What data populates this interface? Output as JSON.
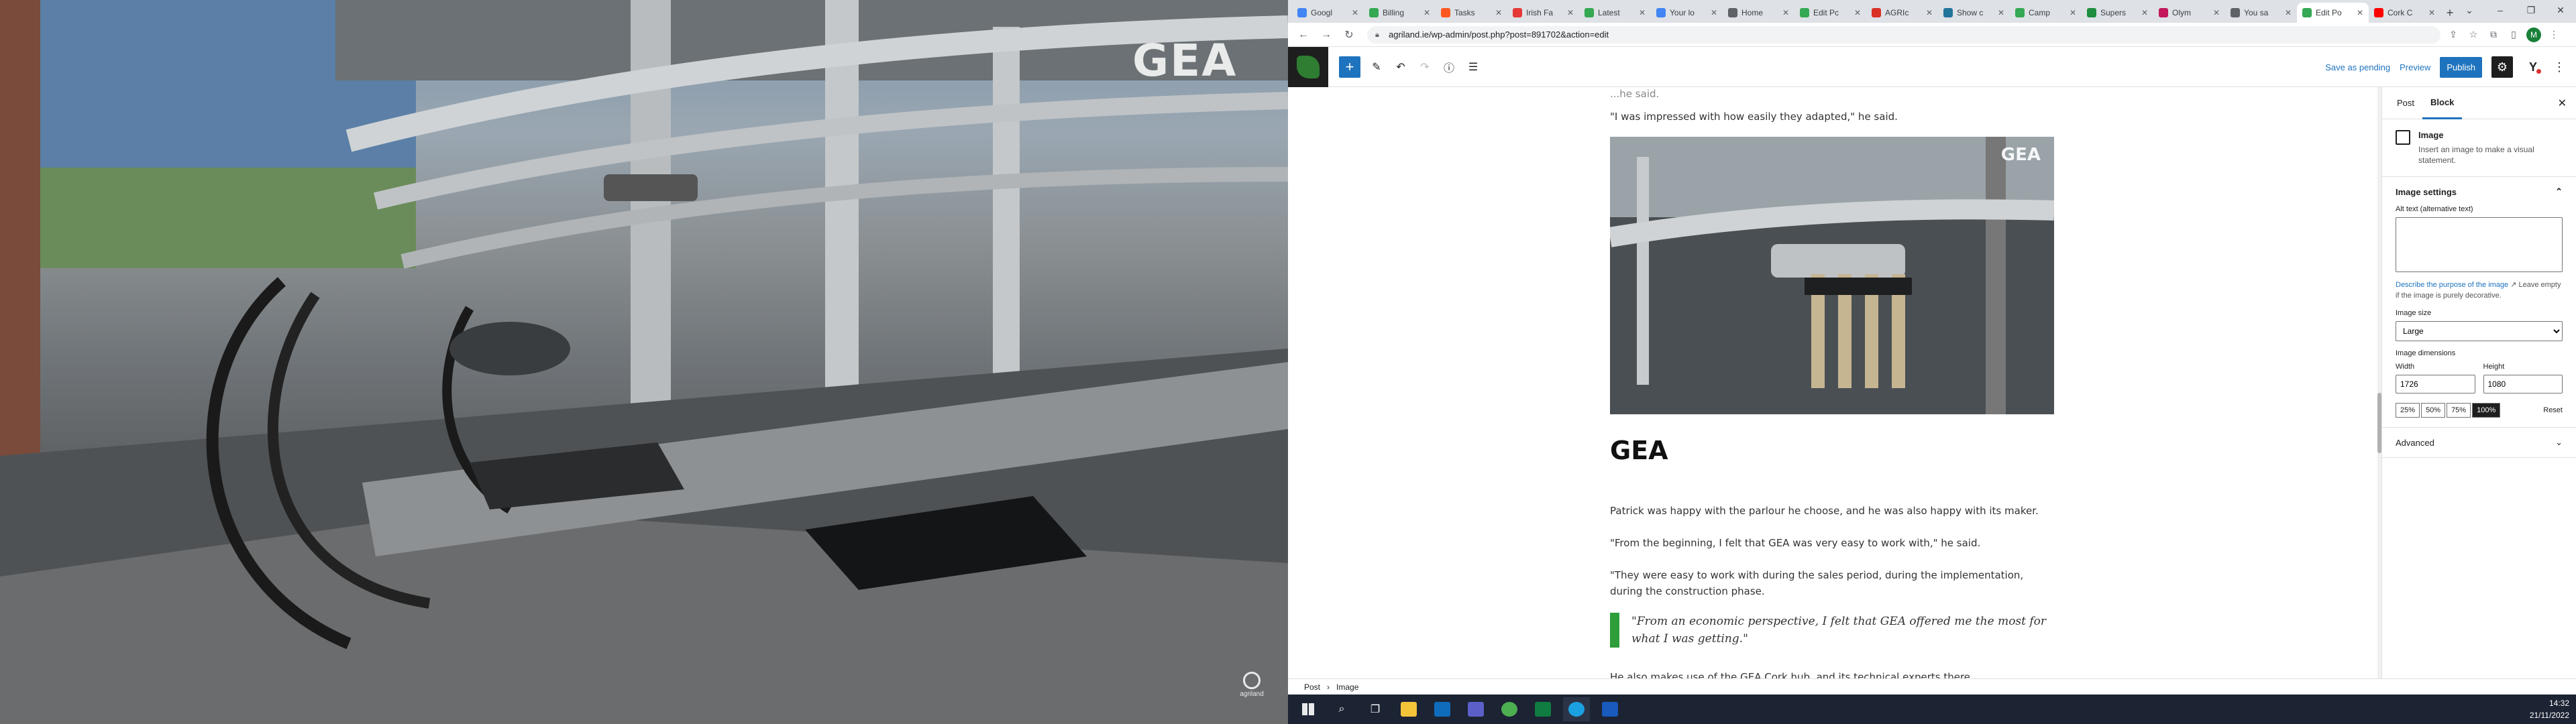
{
  "photo": {
    "watermark": "GEA",
    "badge_text": "agriland"
  },
  "browser": {
    "tabs": [
      {
        "title": "Googl",
        "color": "#4285f4",
        "active": false
      },
      {
        "title": "Billing",
        "color": "#34a853",
        "active": false
      },
      {
        "title": "Tasks",
        "color": "#ff5722",
        "active": false
      },
      {
        "title": "Irish Fa",
        "color": "#e53935",
        "active": false
      },
      {
        "title": "Latest",
        "color": "#34a853",
        "active": false
      },
      {
        "title": "Your lo",
        "color": "#4285f4",
        "active": false
      },
      {
        "title": "Home",
        "color": "#5f6368",
        "active": false
      },
      {
        "title": "Edit Pc",
        "color": "#34a853",
        "active": false
      },
      {
        "title": "AGRIc",
        "color": "#d93025",
        "active": false
      },
      {
        "title": "Show c",
        "color": "#21759b",
        "active": false
      },
      {
        "title": "Camp",
        "color": "#34a853",
        "active": false
      },
      {
        "title": "Supers",
        "color": "#1e8e3e",
        "active": false
      },
      {
        "title": "Olym",
        "color": "#c2185b",
        "active": false
      },
      {
        "title": "You sa",
        "color": "#5f6368",
        "active": false
      },
      {
        "title": "Edit Po",
        "color": "#34a853",
        "active": true
      },
      {
        "title": "Cork C",
        "color": "#ff0000",
        "active": false
      }
    ],
    "new_tab": "+",
    "window_controls": [
      "⌄",
      "–",
      "❐",
      "✕"
    ],
    "url": "agriland.ie/wp-admin/post.php?post=891702&action=edit",
    "profile_initial": "M"
  },
  "wp": {
    "save_pending": "Save as pending",
    "preview": "Preview",
    "publish": "Publish",
    "yoast": "Y"
  },
  "article": {
    "p_top_partial": "...he said.",
    "p_impressed": "\"I was impressed with how easily they adapted,\" he said.",
    "figure_watermark": "GEA",
    "heading": "GEA",
    "p1": "Patrick was happy with the parlour he choose, and he was also happy with its maker.",
    "p2": "\"From the beginning, I felt that GEA was very easy to work with,\" he said.",
    "p3": "\"They were easy to work with during the sales period, during the implementation, during the construction phase.",
    "quote": "\"From an economic perspective, I felt that GEA offered me the most for what I was getting.\"",
    "p4_partial": "He also makes use of the GEA Cork hub, and its technical experts there."
  },
  "sidebar": {
    "tab_post": "Post",
    "tab_block": "Block",
    "block_title": "Image",
    "block_desc": "Insert an image to make a visual statement.",
    "settings_title": "Image settings",
    "alt_label": "Alt text (alternative text)",
    "alt_link": "Describe the purpose of the image",
    "alt_help": "Leave empty if the image is purely decorative.",
    "size_label": "Image size",
    "size_value": "Large",
    "dims_label": "Image dimensions",
    "width_label": "Width",
    "width_value": "1726",
    "height_label": "Height",
    "height_value": "1080",
    "pct": [
      "25%",
      "50%",
      "75%",
      "100%"
    ],
    "reset": "Reset",
    "advanced": "Advanced"
  },
  "breadcrumb": [
    "Post",
    "Image"
  ],
  "clock": {
    "time": "14:32",
    "date": "21/11/2022"
  }
}
